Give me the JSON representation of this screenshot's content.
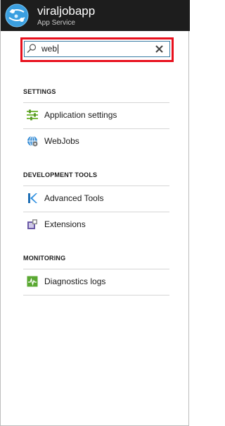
{
  "header": {
    "app_name": "viraljobapp",
    "app_type": "App Service"
  },
  "search": {
    "value": "web",
    "placeholder": ""
  },
  "sections": [
    {
      "title": "SETTINGS",
      "items": [
        {
          "label": "Application settings",
          "icon": "settings-sliders-icon"
        },
        {
          "label": "WebJobs",
          "icon": "webjobs-icon"
        }
      ]
    },
    {
      "title": "DEVELOPMENT TOOLS",
      "items": [
        {
          "label": "Advanced Tools",
          "icon": "kudu-icon"
        },
        {
          "label": "Extensions",
          "icon": "extensions-icon"
        }
      ]
    },
    {
      "title": "MONITORING",
      "items": [
        {
          "label": "Diagnostics logs",
          "icon": "diagnostics-logs-icon"
        }
      ]
    }
  ],
  "colors": {
    "header_bg": "#1d1d1d",
    "highlight": "#e8101d",
    "search_border": "#3a7ca5",
    "divider": "#d6d6d6"
  }
}
